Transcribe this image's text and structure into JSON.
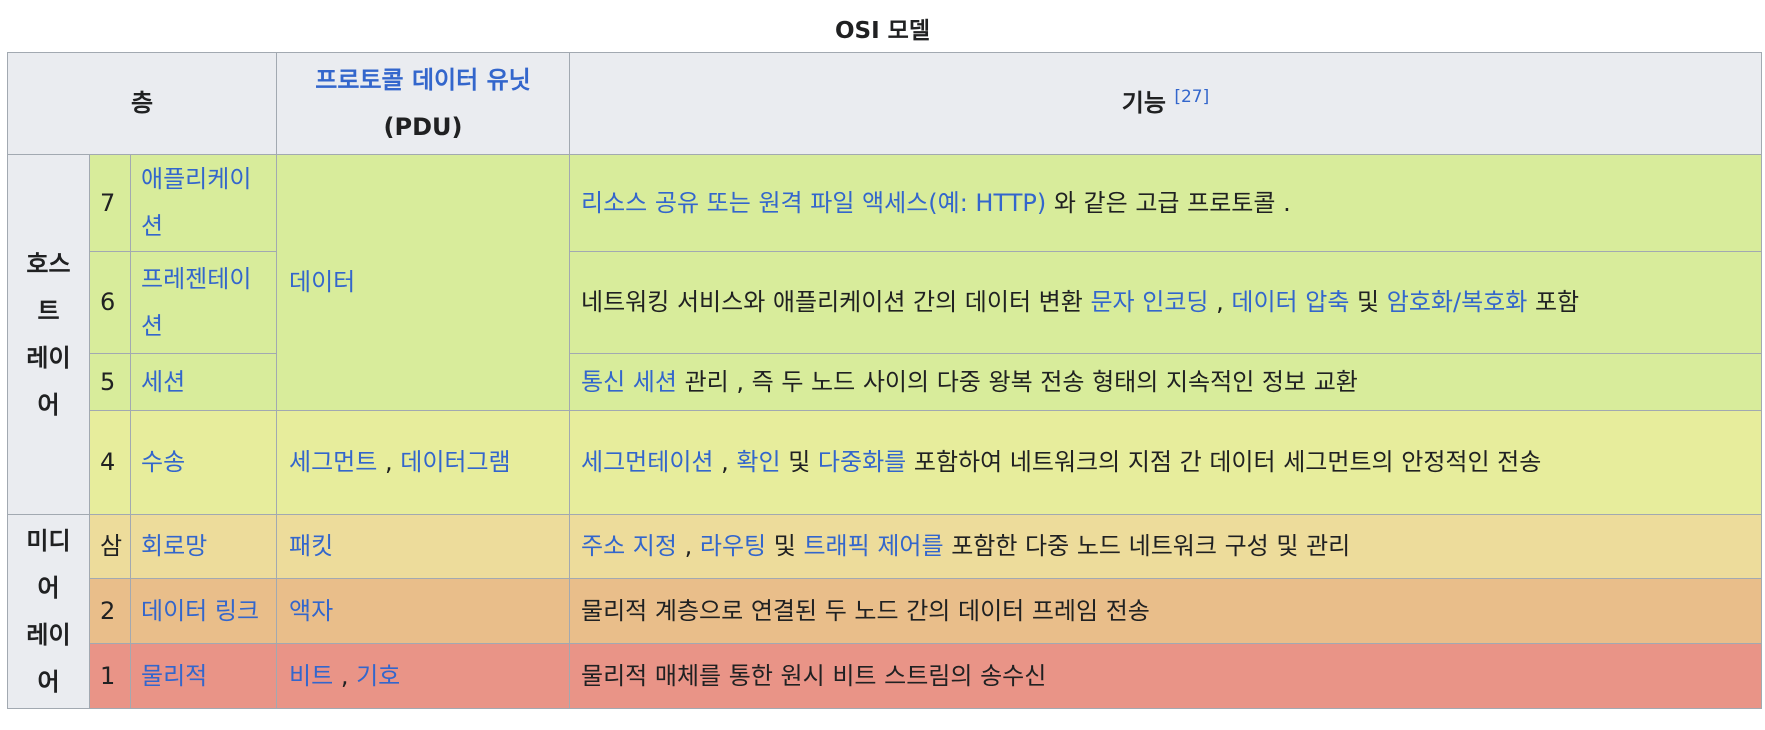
{
  "caption": "OSI 모델",
  "header": {
    "layer": "층",
    "pdu_link": "프로토콜 데이터 유닛",
    "pdu_abbr": "(PDU)",
    "function": "기능",
    "function_ref": "[27]"
  },
  "groups": {
    "host": [
      "호스",
      "트",
      "레이",
      "어"
    ],
    "media": [
      "미디",
      "어",
      "레이",
      "어"
    ]
  },
  "rows": [
    {
      "num": "7",
      "name": [
        "애플리케이",
        "션"
      ],
      "pdu": "데이터",
      "func": {
        "t0": "리소스 공유 또는 원격 파일 액세스(예: HTTP)",
        "t1": " 와 같은 고급 프로토콜 ."
      }
    },
    {
      "num": "6",
      "name": [
        "프레젠테이",
        "션"
      ],
      "func": {
        "t0": "네트워킹 서비스와 애플리케이션 간의 데이터 변환 ",
        "t1": "문자 인코딩",
        "t2": " , ",
        "t3": "데이터 압축",
        "t4": " 및 ",
        "t5": "암호화/복호화",
        "t6": " 포함"
      }
    },
    {
      "num": "5",
      "name": [
        "세션"
      ],
      "func": {
        "t0": "통신 세션",
        "t1": " 관리 , 즉 두 노드 사이의 다중 왕복 전송 형태의 지속적인 정보 교환"
      }
    },
    {
      "num": "4",
      "name": [
        "수송"
      ],
      "pdu": [
        "세그먼트",
        " , ",
        "데이터그램"
      ],
      "func": {
        "t0": "세그먼테이션",
        "t1": " , ",
        "t2": "확인",
        "t3": " 및 ",
        "t4": "다중화를",
        "t5": " 포함하여 네트워크의 지점 간 데이터 세그먼트의 안정적인 전송"
      }
    },
    {
      "num": "삼",
      "name": [
        "회로망"
      ],
      "pdu": "패킷",
      "func": {
        "t0": "주소 지정",
        "t1": " , ",
        "t2": "라우팅",
        "t3": " 및 ",
        "t4": "트래픽 제어를",
        "t5": " 포함한 다중 노드 네트워크 구성 및 관리"
      }
    },
    {
      "num": "2",
      "name": [
        "데이터 링크"
      ],
      "pdu": "액자",
      "func": {
        "t0": "물리적 계층으로 연결된 두 노드 간의 데이터 프레임 전송"
      }
    },
    {
      "num": "1",
      "name": [
        "물리적"
      ],
      "pdu": [
        "비트",
        " , ",
        "기호"
      ],
      "func": {
        "t0": "물리적 매체를 통한 원시 비트 스트림의 송수신"
      }
    }
  ],
  "colors": {
    "link": "#3366cc",
    "header_bg": "#eaecf0",
    "application_layers": "#d8ec9b",
    "transport": "#e7ed9c",
    "network": "#eddc9b",
    "data_link": "#e9be8a",
    "physical": "#e99487"
  }
}
